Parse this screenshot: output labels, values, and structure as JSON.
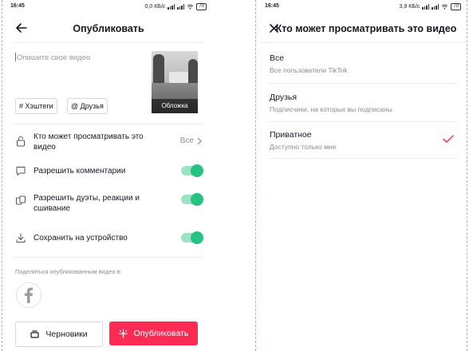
{
  "left": {
    "status": {
      "time": "16:45",
      "net": "0,0 КБ/с",
      "battery": "70"
    },
    "title": "Опубликовать",
    "description_placeholder": "Опишите свое видео",
    "cover_label": "Обложка",
    "chips": [
      "# Хэштеги",
      "@ Друзья"
    ],
    "visibility": {
      "label": "Кто может просматривать это видео",
      "value": "Все"
    },
    "comments": {
      "label": "Разрешить комментарии",
      "on": true
    },
    "duets": {
      "label": "Разрешить дуэты, реакции и сшивание",
      "on": true
    },
    "save": {
      "label": "Сохранить на устройство",
      "on": true
    },
    "share_label": "Поделиться опубликованным видео в:",
    "drafts_label": "Черновики",
    "publish_label": "Опубликовать"
  },
  "right": {
    "status": {
      "time": "16:45",
      "net": "3,9 КБ/с",
      "battery": "70"
    },
    "title": "Кто может просматривать это видео",
    "options": [
      {
        "title": "Все",
        "subtitle": "Все пользователи TikTok",
        "selected": false
      },
      {
        "title": "Друзья",
        "subtitle": "Подписчики, на которых вы подписаны",
        "selected": false
      },
      {
        "title": "Приватное",
        "subtitle": "Доступно только мне",
        "selected": true
      }
    ]
  },
  "colors": {
    "accent": "#fe2c55",
    "toggle": "#25c281",
    "check": "#fe2c55"
  }
}
